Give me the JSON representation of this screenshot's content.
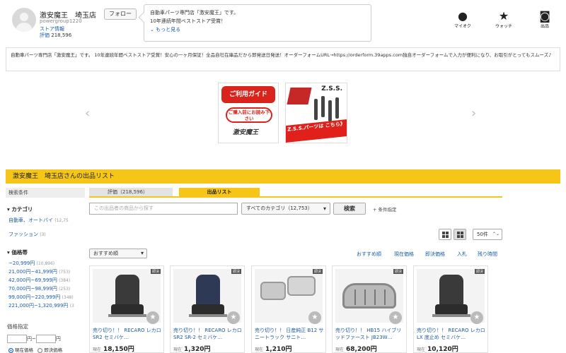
{
  "header": {
    "store_name": "激安魔王　埼玉店",
    "store_id": "powergroup1220",
    "store_info_link": "ストア情報",
    "rating_label": "評価",
    "rating_count": "218,596",
    "follow_label": "フォロー",
    "bubble_line1": "自動車パーツ専門店「激安魔王」です。",
    "bubble_line2": "10年連続年間ベストストア受賞！",
    "bubble_more": "もっと見る",
    "icons": [
      {
        "label": "マイオク",
        "icon": "person-icon"
      },
      {
        "label": "ウォッチ",
        "icon": "star-icon"
      },
      {
        "label": "出品",
        "icon": "camera-icon"
      }
    ]
  },
  "description": "自動車パーツ専門店「激安魔王」です。 10年連続年間ベストストア受賞！安心の一ヶ月保証！全品自社在庫品だから即発送日発送！オーダーフォームURL→https://orderform.39apps.com独自オーダーフォームで入力が便利になり、お取引がとってもスムーズ♪",
  "banners": {
    "guide_title": "ご利用ガイド",
    "guide_sub": "ご購入前にお読み下さい",
    "guide_sig": "激安魔王",
    "zss_logo": "Z.S.S.",
    "zss_strip": "Z.S.S.パーツは こちら》"
  },
  "list_bar": "激安魔王　埼玉店さんの出品リスト",
  "tabs": {
    "rating": "評価（218,596）",
    "list": "出品リスト"
  },
  "sidebar": {
    "header": "検索条件",
    "category_title": "カテゴリ",
    "categories": [
      {
        "label": "自動車、オートバイ",
        "count": "(12,75"
      },
      {
        "label": "ファッション",
        "count": "(3)"
      }
    ],
    "price_title": "価格帯",
    "price_ranges": [
      {
        "label": "~20,999円",
        "count": "(10,896)"
      },
      {
        "label": "21,000円~41,999円",
        "count": "(753)"
      },
      {
        "label": "42,000円~69,999円",
        "count": "(384)"
      },
      {
        "label": "70,000円~98,999円",
        "count": "(253)"
      },
      {
        "label": "99,000円~220,999円",
        "count": "(348)"
      },
      {
        "label": "221,000円~1,320,999円",
        "count": "(3"
      }
    ],
    "price_spec_title": "価格指定",
    "price_from_suffix": "円~",
    "price_to_suffix": "円",
    "radio_current": "現在価格",
    "radio_buynow": "即決価格"
  },
  "search": {
    "placeholder": "この出品者の商品から探す",
    "category_select": "すべてのカテゴリ（12,753）",
    "button": "検索",
    "conditions": "条件指定"
  },
  "view": {
    "per_page": "50件"
  },
  "sort": {
    "selected": "おすすめ順",
    "links": [
      "おすすめ順",
      "現在価格",
      "即決価格",
      "入札",
      "残り時間"
    ]
  },
  "products": [
    {
      "title": "売り切り！！ RECARO レカロ SR2 セミバケ…",
      "price_label": "現在",
      "price": "18,150円",
      "tag": "即決",
      "image": "seat-black"
    },
    {
      "title": "売り切り！！ RECARO レカロ SR2 SR-2 セミバケ…",
      "price_label": "現在",
      "price": "1,320円",
      "tag": "即決",
      "image": "seat-blue"
    },
    {
      "title": "売り切り！！ 日産純正 B12 サニートラック サニト…",
      "price_label": "現在",
      "price": "1,210円",
      "tag": "即決",
      "image": "mirror"
    },
    {
      "title": "売り切り！！ HB15 ハイブリッドファースト JB23W…",
      "price_label": "現在",
      "price": "68,200円",
      "tag": "即決",
      "image": "grill"
    },
    {
      "title": "売り切り！！ RECARO レカロ LX 底止め セミバケ…",
      "price_label": "現在",
      "price": "10,120円",
      "tag": "即決",
      "image": "seat-black"
    }
  ]
}
